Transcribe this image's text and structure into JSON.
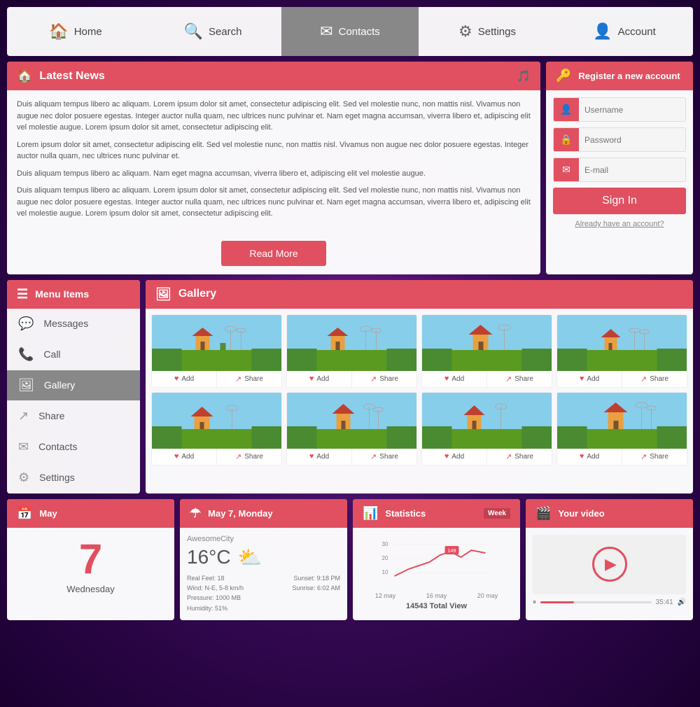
{
  "nav": {
    "items": [
      {
        "label": "Home",
        "icon": "🏠",
        "active": false
      },
      {
        "label": "Search",
        "icon": "🔍",
        "active": false
      },
      {
        "label": "Contacts",
        "icon": "✉",
        "active": true
      },
      {
        "label": "Settings",
        "icon": "⚙",
        "active": false
      },
      {
        "label": "Account",
        "icon": "👤",
        "active": false
      }
    ]
  },
  "news": {
    "title": "Latest News",
    "paragraphs": [
      "Duis aliquam tempus libero ac aliquam. Lorem ipsum dolor sit amet, consectetur adipiscing elit. Sed vel molestie nunc, non mattis nisl. Vivamus non augue nec dolor posuere egestas. Integer auctor nulla quam, nec ultrices nunc pulvinar et. Nam eget magna accumsan, viverra libero et, adipiscing elit vel molestie augue. Lorem ipsum dolor sit amet, consectetur adipiscing elit.",
      "Lorem ipsum dolor sit amet, consectetur adipiscing elit. Sed vel molestie nunc, non mattis nisl. Vivamus non augue nec dolor posuere egestas. Integer auctor nulla quam, nec ultrices nunc pulvinar et.",
      "Duis aliquam tempus libero ac aliquam. Nam eget magna accumsan, viverra libero et, adipiscing elit vel molestie augue.",
      "Duis aliquam tempus libero ac aliquam. Lorem ipsum dolor sit amet, consectetur adipiscing elit. Sed vel molestie nunc, non mattis nisl. Vivamus non augue nec dolor posuere egestas. Integer auctor nulla quam, nec ultrices nunc pulvinar et. Nam eget magna accumsan, viverra libero et, adipiscing elit vel molestie augue. Lorem ipsum dolor sit amet, consectetur adipiscing elit."
    ],
    "read_more": "Read More"
  },
  "account": {
    "title": "Register a new account",
    "username_placeholder": "Username",
    "password_placeholder": "Password",
    "email_placeholder": "E-mail",
    "sign_in": "Sign In",
    "already": "Already have an account?"
  },
  "menu": {
    "title": "Menu Items",
    "items": [
      {
        "label": "Messages",
        "icon": "💬",
        "active": false
      },
      {
        "label": "Call",
        "icon": "📞",
        "active": false
      },
      {
        "label": "Gallery",
        "icon": "🖼",
        "active": true
      },
      {
        "label": "Share",
        "icon": "↗",
        "active": false
      },
      {
        "label": "Contacts",
        "icon": "✉",
        "active": false
      },
      {
        "label": "Settings",
        "icon": "⚙",
        "active": false
      }
    ]
  },
  "gallery": {
    "title": "Gallery",
    "add_label": "Add",
    "share_label": "Share",
    "items": [
      1,
      2,
      3,
      4,
      5,
      6,
      7,
      8
    ]
  },
  "calendar": {
    "title": "May",
    "day": "7",
    "weekday": "Wednesday"
  },
  "weather": {
    "title": "May 7, Monday",
    "city": "AwesomeCity",
    "temp": "16°C",
    "real_feel": "Real Feel: 18",
    "wind": "Wind: N-E, 5-8 km/h",
    "sunset": "Sunset: 9:18 PM",
    "sunrise": "Sunrise: 6:02 AM",
    "pressure": "Pressure: 1000 MB",
    "humidity": "Humidity: 51%"
  },
  "statistics": {
    "title": "Statistics",
    "week_label": "Week",
    "total_label": "14543 Total View",
    "badge_value": "149",
    "chart_labels": [
      "12 may",
      "16 may",
      "20 may"
    ],
    "y_labels": [
      "30",
      "20",
      "10"
    ]
  },
  "video": {
    "title": "Your video",
    "time": "35:41"
  }
}
